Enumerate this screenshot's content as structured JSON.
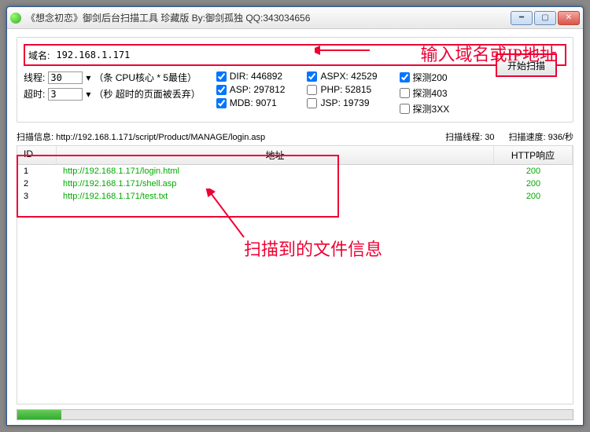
{
  "title": "《想念初恋》御剑后台扫描工具 珍藏版 By:御剑孤独 QQ:343034656",
  "domain": {
    "label": "域名:",
    "value": "192.168.1.171"
  },
  "threads": {
    "label": "线程:",
    "value": "30",
    "hint": "（条 CPU核心 * 5最佳）"
  },
  "timeout": {
    "label": "超时:",
    "value": "3",
    "hint": "（秒 超时的页面被丢弃）"
  },
  "checks": {
    "col1": [
      {
        "label": "DIR: 446892",
        "checked": true
      },
      {
        "label": "ASP: 297812",
        "checked": true
      },
      {
        "label": "MDB: 9071",
        "checked": true
      }
    ],
    "col2": [
      {
        "label": "ASPX: 42529",
        "checked": true
      },
      {
        "label": "PHP: 52815",
        "checked": false
      },
      {
        "label": "JSP: 19739",
        "checked": false
      }
    ],
    "col3": [
      {
        "label": "探测200",
        "checked": true
      },
      {
        "label": "探测403",
        "checked": false
      },
      {
        "label": "探测3XX",
        "checked": false
      }
    ]
  },
  "run_button": "开始扫描",
  "status": {
    "info_label": "扫描信息:",
    "info_value": "http://192.168.1.171/script/Product/MANAGE/login.asp",
    "threads_label": "扫描线程:",
    "threads_value": "30",
    "speed_label": "扫描速度:",
    "speed_value": "936/秒"
  },
  "columns": {
    "id": "ID",
    "url": "地址",
    "resp": "HTTP响应"
  },
  "rows": [
    {
      "id": "1",
      "url": "http://192.168.1.171/login.html",
      "resp": "200"
    },
    {
      "id": "2",
      "url": "http://192.168.1.171/shell.asp",
      "resp": "200"
    },
    {
      "id": "3",
      "url": "http://192.168.1.171/test.txt",
      "resp": "200"
    }
  ],
  "annotations": {
    "a1": "输入域名或IP地址",
    "a2": "扫描到的文件信息"
  }
}
